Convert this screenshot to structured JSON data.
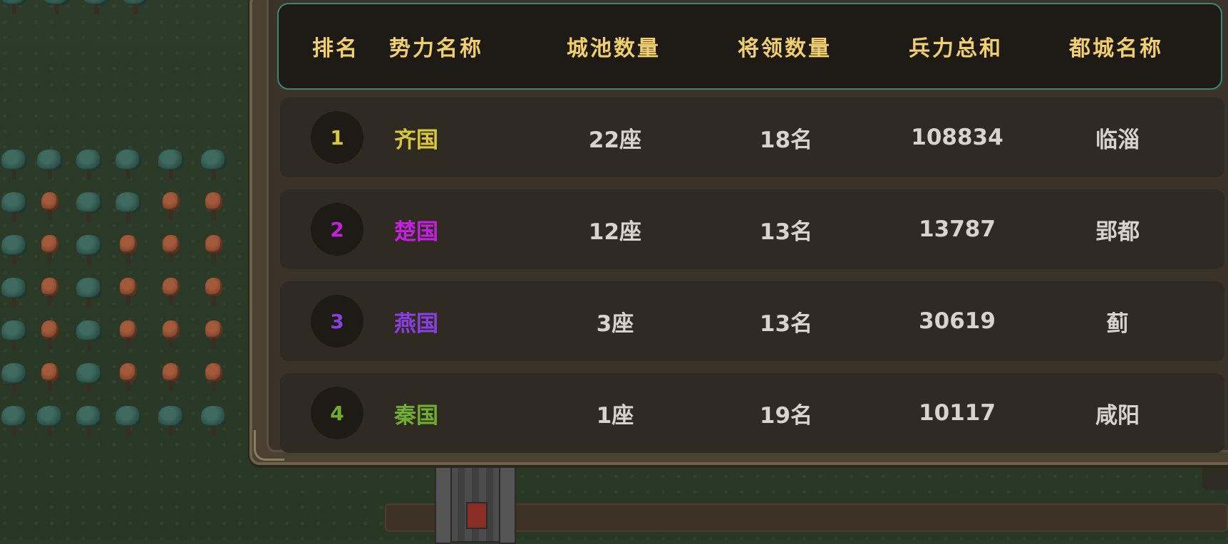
{
  "ranking_table": {
    "headers": {
      "rank": "排名",
      "faction_name": "势力名称",
      "city_count": "城池数量",
      "general_count": "将领数量",
      "total_troops": "兵力总和",
      "capital_name": "都城名称"
    },
    "rows": [
      {
        "rank": "1",
        "faction_name": "齐国",
        "city_count": "22座",
        "general_count": "18名",
        "total_troops": "108834",
        "capital_name": "临淄",
        "color": "#d9c93a"
      },
      {
        "rank": "2",
        "faction_name": "楚国",
        "city_count": "12座",
        "general_count": "13名",
        "total_troops": "13787",
        "capital_name": "郢都",
        "color": "#c61fe0"
      },
      {
        "rank": "3",
        "faction_name": "燕国",
        "city_count": "3座",
        "general_count": "13名",
        "total_troops": "30619",
        "capital_name": "蓟",
        "color": "#8a3fe0"
      },
      {
        "rank": "4",
        "faction_name": "秦国",
        "city_count": "1座",
        "general_count": "19名",
        "total_troops": "10117",
        "capital_name": "咸阳",
        "color": "#6fae2e"
      }
    ]
  },
  "colors": {
    "header_text": "#f1cf6d",
    "header_border": "#3d8577",
    "body_text": "#d8d4cc"
  },
  "icons": [
    "tree-icon",
    "castle-icon"
  ]
}
